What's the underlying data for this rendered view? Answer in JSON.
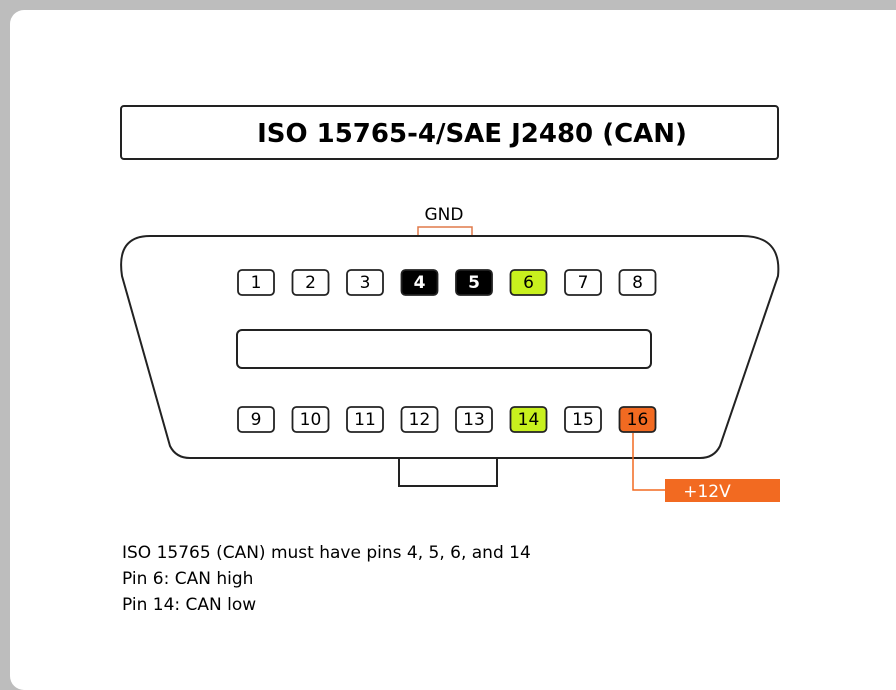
{
  "title": "ISO 15765-4/SAE J2480 (CAN)",
  "gnd_label": "GND",
  "power_label": "+12V",
  "colors": {
    "black_pin": "#000000",
    "can_pin": "#c8f01e",
    "power_pin": "#f26a21",
    "frame": "#bdbdbd"
  },
  "pins_top": [
    {
      "label": "1",
      "style": "normal"
    },
    {
      "label": "2",
      "style": "normal"
    },
    {
      "label": "3",
      "style": "normal"
    },
    {
      "label": "4",
      "style": "black"
    },
    {
      "label": "5",
      "style": "black"
    },
    {
      "label": "6",
      "style": "green"
    },
    {
      "label": "7",
      "style": "normal"
    },
    {
      "label": "8",
      "style": "normal"
    }
  ],
  "pins_bottom": [
    {
      "label": "9",
      "style": "normal"
    },
    {
      "label": "10",
      "style": "normal"
    },
    {
      "label": "11",
      "style": "normal"
    },
    {
      "label": "12",
      "style": "normal"
    },
    {
      "label": "13",
      "style": "normal"
    },
    {
      "label": "14",
      "style": "green"
    },
    {
      "label": "15",
      "style": "normal"
    },
    {
      "label": "16",
      "style": "orange"
    }
  ],
  "notes": [
    "ISO 15765 (CAN) must have pins 4, 5, 6, and 14",
    "Pin 6: CAN high",
    "Pin 14: CAN low"
  ]
}
